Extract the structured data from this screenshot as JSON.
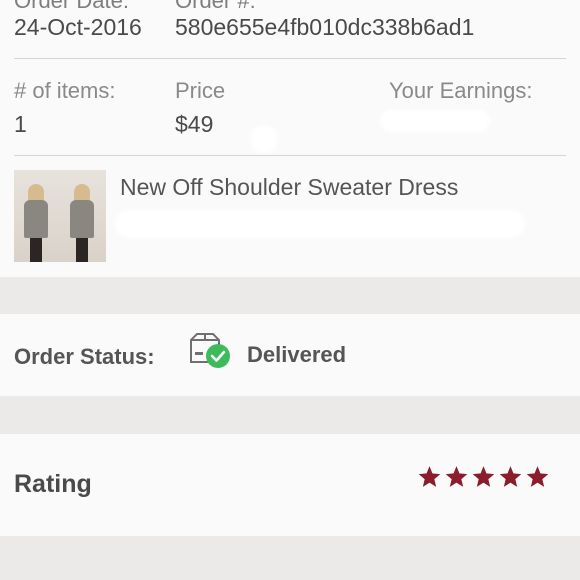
{
  "order": {
    "date_label": "Order Date:",
    "order_label": "Order #:",
    "date": "24-Oct-2016",
    "order_number": "580e655e4fb010dc338b6ad1",
    "items_label": "# of items:",
    "items_value": "1",
    "price_label": "Price",
    "price_value": "$49",
    "earnings_label": "Your Earnings:"
  },
  "product": {
    "title": "New Off Shoulder Sweater Dress",
    "thumbnail": "product-photo"
  },
  "status": {
    "label": "Order Status:",
    "value": "Delivered",
    "icon": "package-delivered-icon",
    "check_color": "#3dbb5b"
  },
  "rating": {
    "label": "Rating",
    "stars": 5,
    "max": 5,
    "star_color": "#8a1c2c"
  }
}
